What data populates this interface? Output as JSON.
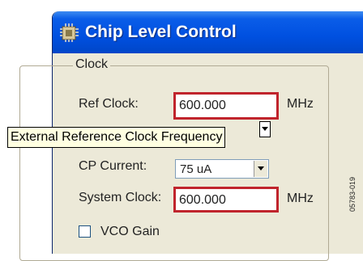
{
  "window": {
    "title": "Chip Level Control",
    "icon": "chip-level-app-icon",
    "title_bar_color": "#0050e0"
  },
  "clock_group": {
    "label": "Clock",
    "ref_clock": {
      "label": "Ref Clock:",
      "value": "600.000",
      "unit": "MHz",
      "highlight_color": "#c0242c"
    },
    "tooltip": {
      "text": "External Reference Clock Frequency"
    },
    "cp_current": {
      "label": "CP Current:",
      "selected": "75 uA"
    },
    "system_clock": {
      "label": "System Clock:",
      "value": "600.000",
      "unit": "MHz"
    },
    "vco_gain": {
      "label": "VCO Gain",
      "checked": false
    }
  },
  "figure_id": "05783-019"
}
